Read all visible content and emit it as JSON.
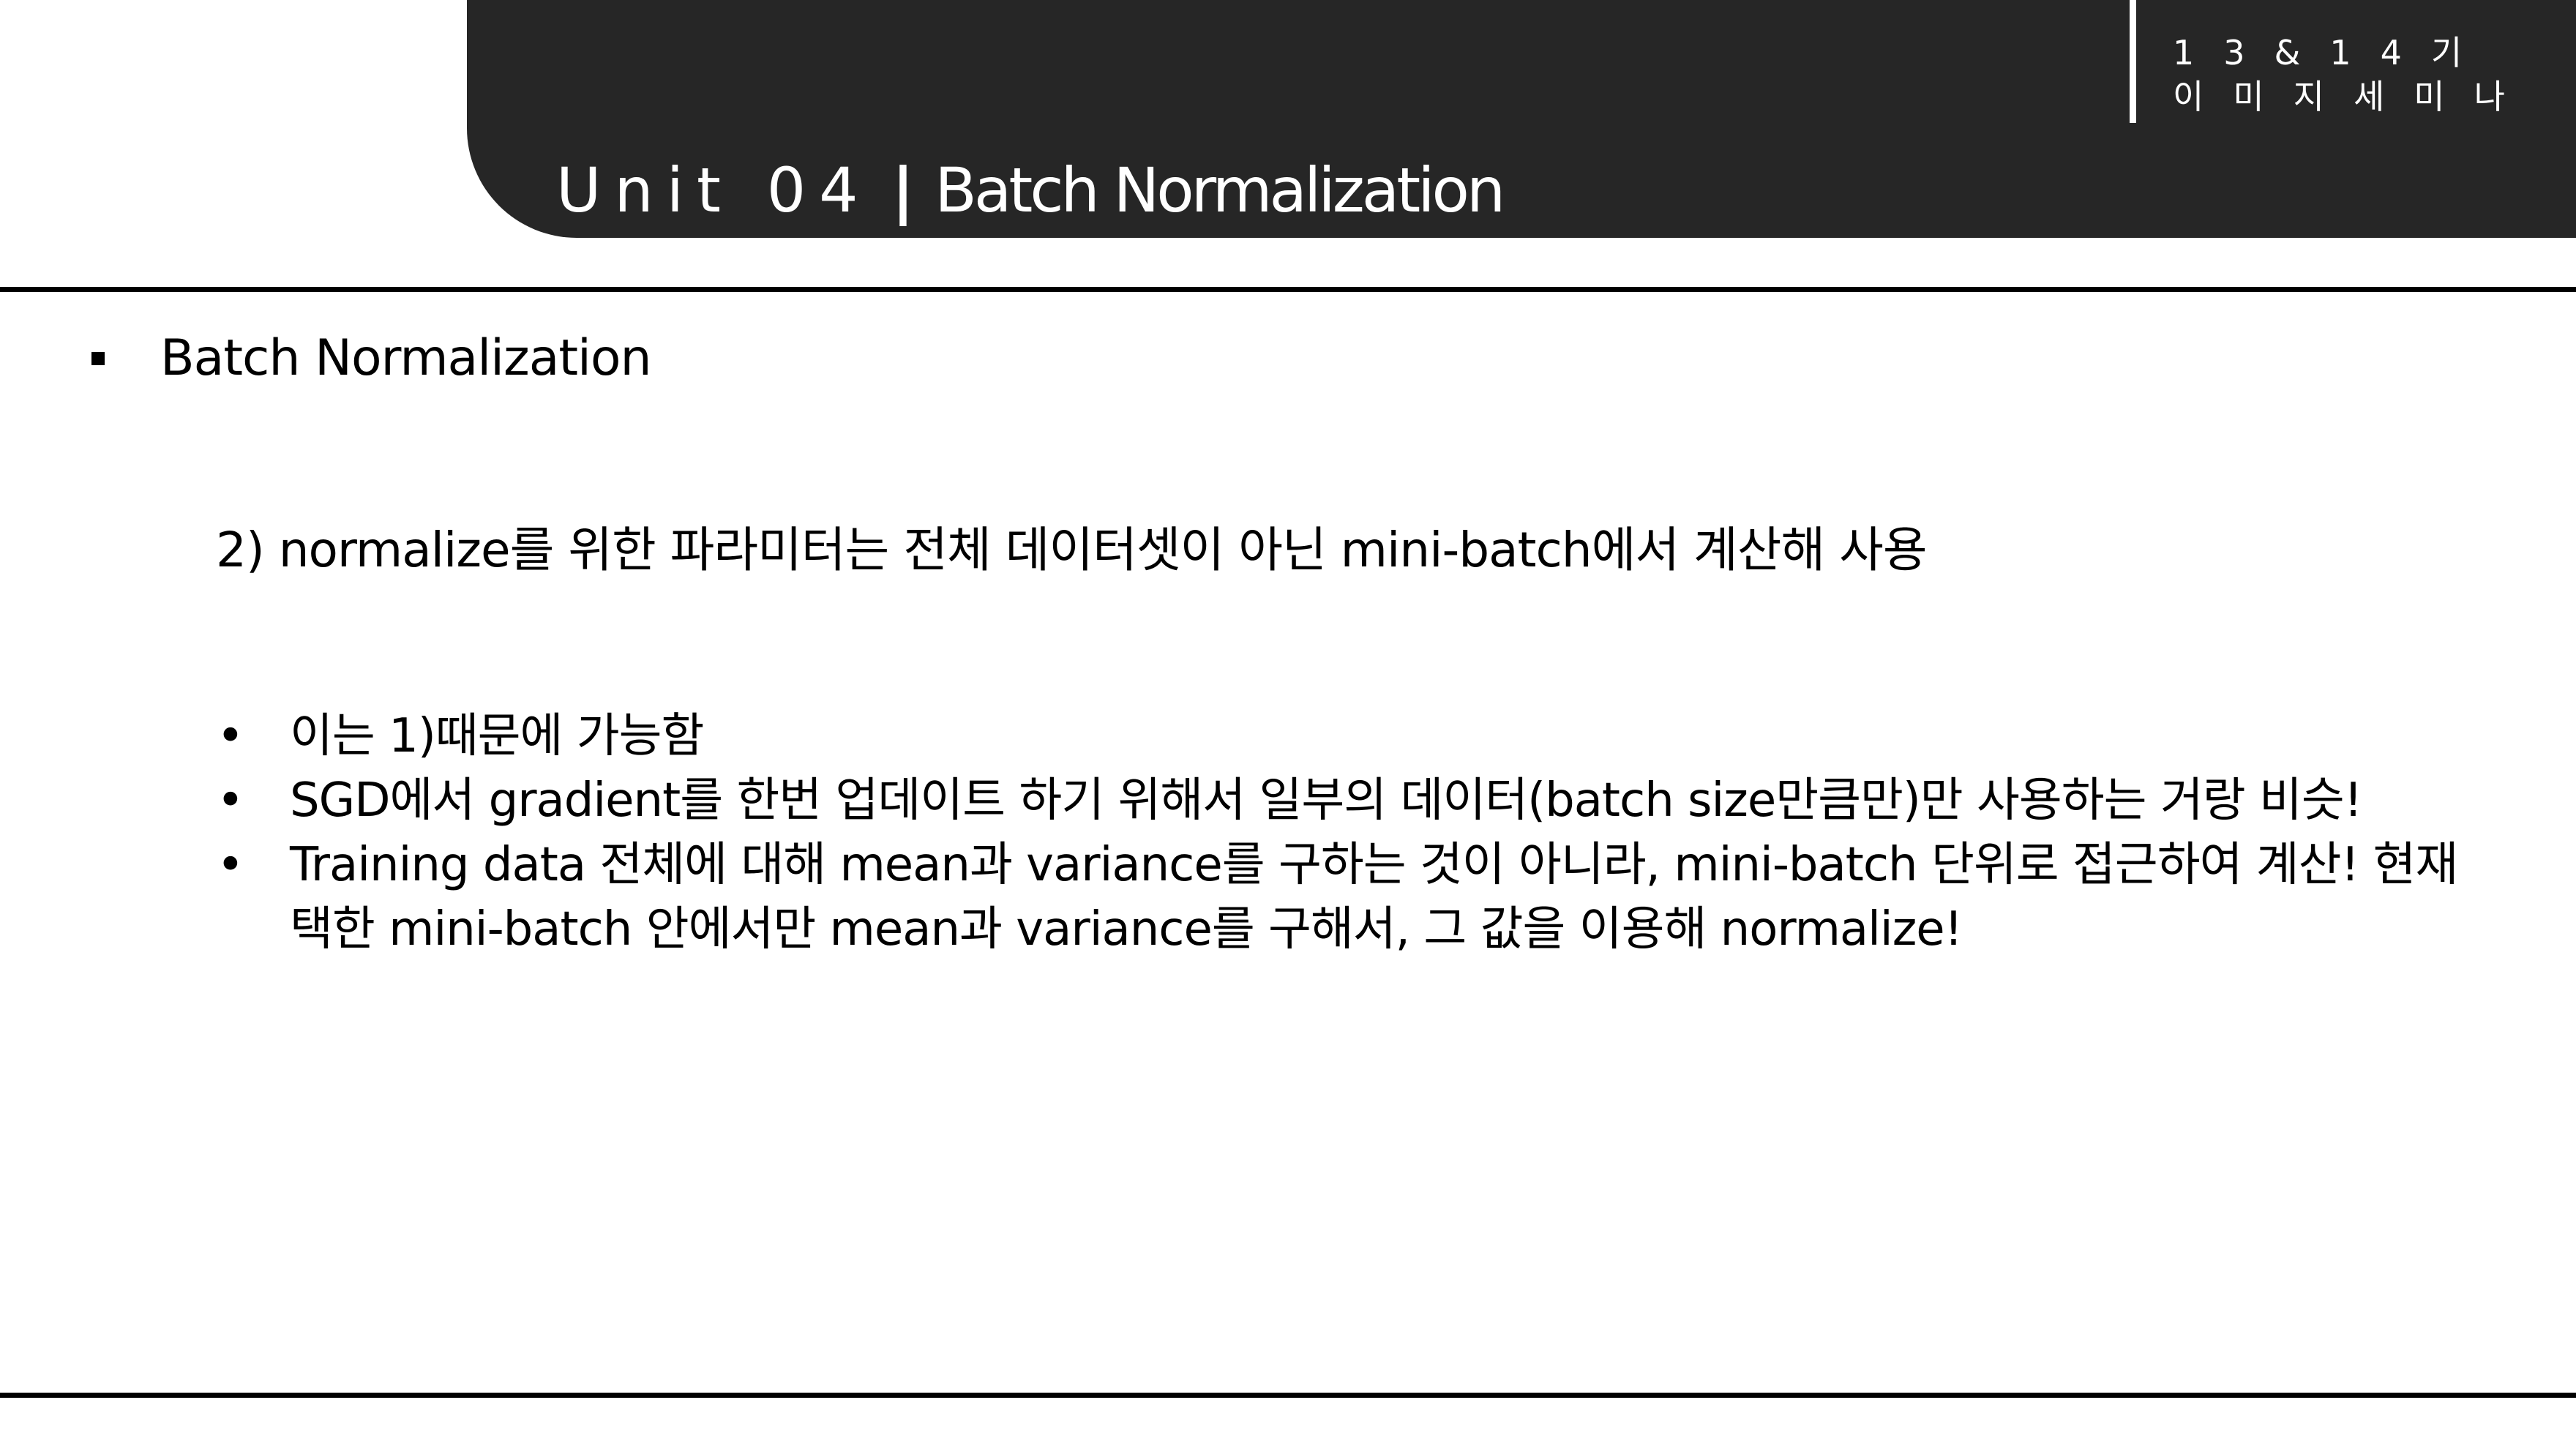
{
  "header": {
    "unit_label": "Unit 04",
    "separator": "|",
    "unit_name": "Batch Normalization",
    "seminar_line1": "13&14기",
    "seminar_line2": "이미지세미나",
    "band_color": "#262626"
  },
  "content": {
    "section_title": "Batch Normalization",
    "point": "2) normalize를 위한 파라미터는 전체 데이터셋이 아닌 mini-batch에서 계산해 사용",
    "bullets": [
      "이는 1)때문에 가능함",
      "SGD에서 gradient를 한번 업데이트 하기 위해서 일부의 데이터(batch size만큼만)만 사용하는 거랑 비슷!",
      "Training data 전체에 대해 mean과 variance를 구하는 것이 아니라, mini-batch 단위로 접근하여 계산! 현재 택한 mini-batch 안에서만 mean과 variance를 구해서, 그 값을 이용해 normalize!"
    ],
    "bullet_glyph": "•"
  }
}
